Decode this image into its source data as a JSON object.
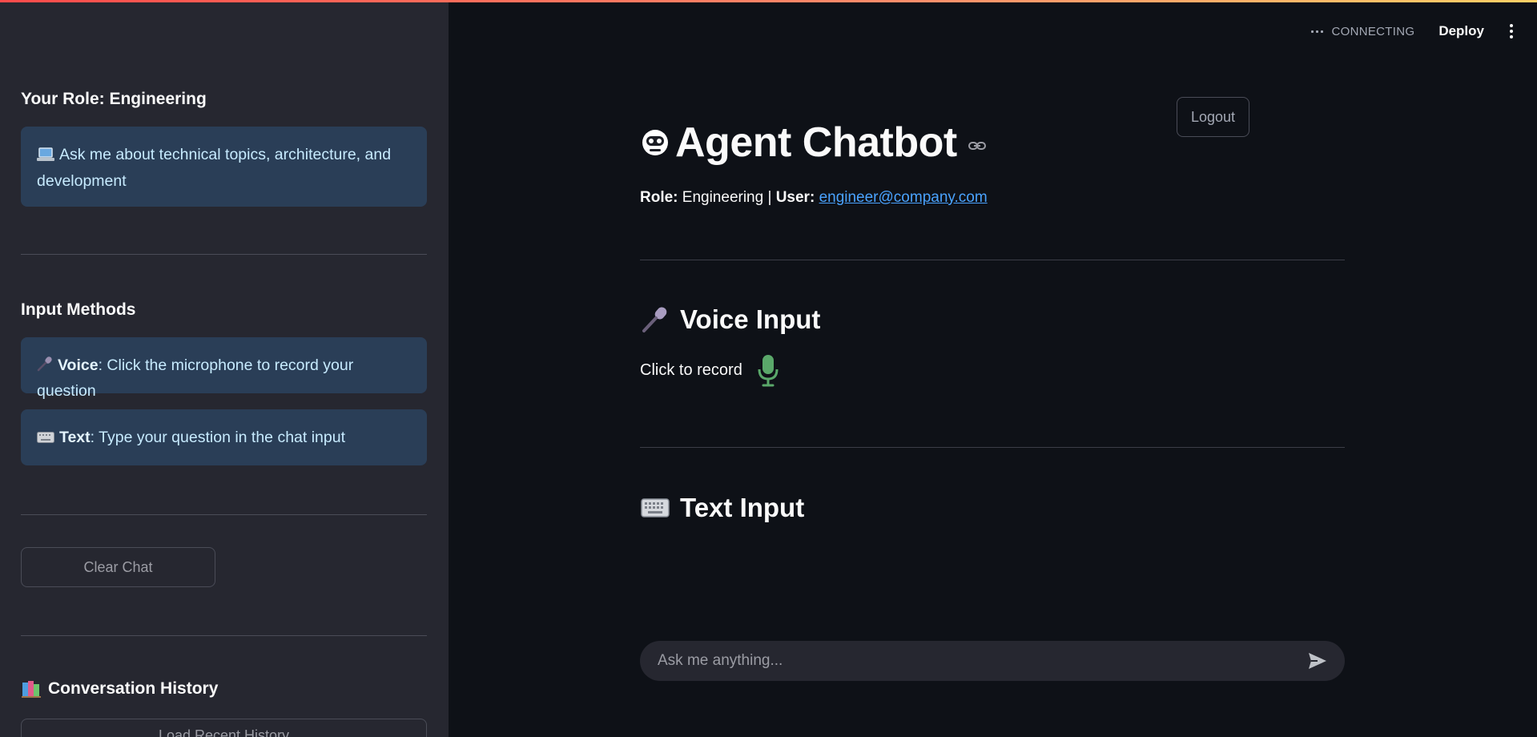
{
  "sidebar": {
    "role_heading": "Your Role: Engineering",
    "role_info": "Ask me about technical topics, architecture, and development",
    "input_methods_heading": "Input Methods",
    "voice_label": "Voice",
    "voice_text": ": Click the microphone to record your question",
    "text_label": "Text",
    "text_text": ": Type your question in the chat input",
    "clear_chat_label": "Clear Chat",
    "history_heading": "Conversation History",
    "load_history_label": "Load Recent History"
  },
  "topbar": {
    "status": "CONNECTING",
    "deploy_label": "Deploy"
  },
  "main": {
    "logout_label": "Logout",
    "title": "Agent Chatbot",
    "role_key": "Role:",
    "role_value": "Engineering",
    "separator": "|",
    "user_key": "User:",
    "user_email": "engineer@company.com",
    "voice_heading": "Voice Input",
    "click_to_record": "Click to record",
    "text_heading": "Text Input",
    "chat_placeholder": "Ask me anything..."
  },
  "colors": {
    "accent_gradient_start": "#ff4b4b",
    "accent_gradient_end": "#ffd166",
    "sidebar_bg": "#262730",
    "main_bg": "#0e1117",
    "link": "#4aa3ff",
    "mic_green": "#5aa86a"
  },
  "icons": [
    "laptop-icon",
    "microphone-icon",
    "keyboard-icon",
    "books-icon",
    "robot-face-icon",
    "link-icon",
    "mic-record-icon",
    "send-icon",
    "kebab-menu-icon"
  ]
}
